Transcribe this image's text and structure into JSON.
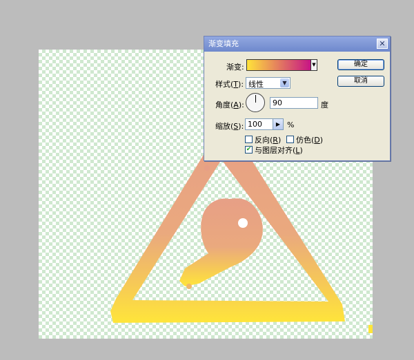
{
  "dialog": {
    "title": "渐变填充",
    "close_glyph": "✕",
    "gradient_label": "渐变:",
    "gradient_colors": [
      "#ffe33a",
      "#c71585"
    ],
    "style_label_pre": "样式(",
    "style_label_key": "T",
    "style_label_post": "):",
    "style_value": "线性",
    "angle_label_pre": "角度(",
    "angle_label_key": "A",
    "angle_label_post": "):",
    "angle_value": "90",
    "angle_unit": "度",
    "scale_label_pre": "缩放(",
    "scale_label_key": "S",
    "scale_label_post": "):",
    "scale_value": "100",
    "scale_unit": "%",
    "reverse_pre": "反向(",
    "reverse_key": "R",
    "reverse_post": ")",
    "reverse_checked": false,
    "dither_pre": "仿色(",
    "dither_key": "D",
    "dither_post": ")",
    "dither_checked": false,
    "align_pre": "与图层对齐(",
    "align_key": "L",
    "align_post": ")",
    "align_checked": true,
    "ok_label": "确定",
    "cancel_label": "取消"
  },
  "canvas": {
    "fill_colors": [
      "#e7a582",
      "#e9aa7c",
      "#ffe23a"
    ],
    "checker_color": "#cfe8cf"
  }
}
